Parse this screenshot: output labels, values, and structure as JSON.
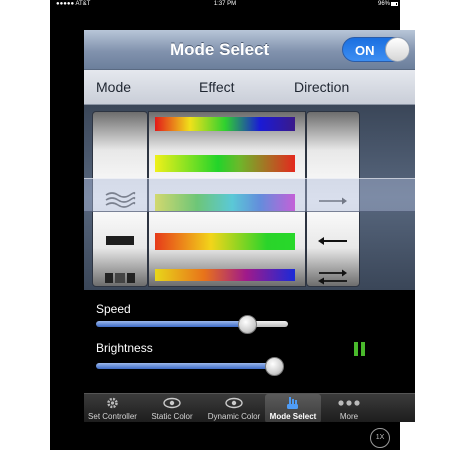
{
  "status_bar": {
    "carrier": "●●●●● AT&T",
    "time": "1:37 PM",
    "battery": "96%"
  },
  "title_bar": {
    "title": "Mode Select",
    "toggle_label": "ON",
    "toggle_on": true
  },
  "columns": {
    "mode": "Mode",
    "effect": "Effect",
    "direction": "Direction"
  },
  "picker": {
    "mode_items": [
      "blank",
      "wave-icon",
      "solid-bar-icon",
      "stripes-icon"
    ],
    "selected_mode": "wave-icon",
    "effect_items": [
      "spectrum red-yellow-green-blue",
      "yellow-green-red",
      "yellow-green-cyan-blue-magenta",
      "orange-yellow-green",
      "yellow-orange-purple-blue"
    ],
    "direction_items": [
      "blank",
      "arrow-right-icon",
      "arrow-left-icon",
      "arrow-both-icon"
    ],
    "selected_direction": "arrow-right-icon"
  },
  "controls": {
    "speed_label": "Speed",
    "speed_value": 0.85,
    "brightness_label": "Brightness",
    "brightness_value": 1.0,
    "pause_icon": "pause-icon",
    "pause_color": "#4aba2c"
  },
  "tabbar": {
    "tabs": [
      {
        "label": "Set Controller",
        "icon": "gear-icon"
      },
      {
        "label": "Static Color",
        "icon": "eye-icon"
      },
      {
        "label": "Dynamic Color",
        "icon": "eye-icon"
      },
      {
        "label": "Mode Select",
        "icon": "hand-icon"
      },
      {
        "label": "More",
        "icon": "more-dots-icon"
      }
    ],
    "active": "Mode Select"
  },
  "zoom_badge": "1X",
  "colors": {
    "accent": "#3d8ef2",
    "title_bar": "#8192ad"
  }
}
